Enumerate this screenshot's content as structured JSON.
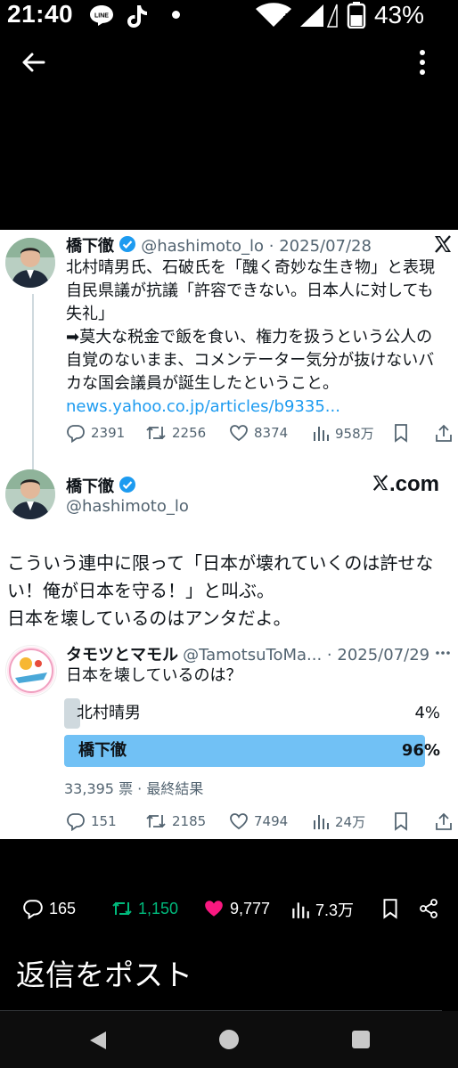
{
  "status_bar": {
    "time": "21:40",
    "battery": "43%",
    "line_badge": "LINE"
  },
  "quoted_tweet": {
    "author_name": "橋下徹",
    "handle_date": "@hashimoto_lo · 2025/07/28",
    "lines": [
      "北村晴男氏、石破氏を「醜く奇妙な生き物」と表現",
      "自民県議が抗議「許容できない。日本人に対しても",
      "失礼」",
      "➡莫大な税金で飯を食い、権力を扱うという公人の",
      "自覚のないまま、コメンテーター気分が抜けないバ",
      "カな国会議員が誕生したということ。"
    ],
    "link": "news.yahoo.co.jp/articles/b9335...",
    "replies": "2391",
    "reposts": "2256",
    "likes": "8374",
    "views": "958万"
  },
  "main_tweet": {
    "author_name": "橋下徹",
    "handle": "@hashimoto_lo",
    "brand": "X.com",
    "brand_rest": ".com",
    "lines": [
      "こういう連中に限って「日本が壊れていくのは許せな",
      "い！俺が日本を守る！」と叫ぶ。",
      "日本を壊しているのはアンタだよ。"
    ]
  },
  "poll_tweet": {
    "author_name": "タモツとマモル",
    "handle_date": "@TamotsuToMa... · 2025/07/29",
    "question": "日本を壊しているのは？",
    "options": [
      {
        "label": "北村晴男",
        "percent": "4%",
        "fraction": 0.04
      },
      {
        "label": "橋下徹",
        "percent": "96%",
        "fraction": 0.96
      }
    ],
    "footer": "33,395 票 · 最終結果",
    "replies": "151",
    "reposts": "2185",
    "likes": "7494",
    "views": "24万"
  },
  "bottom_actions": {
    "replies": "165",
    "reposts": "1,150",
    "likes": "9,777",
    "views": "7.3万"
  },
  "reply_prompt": "返信をポスト",
  "colors": {
    "accent": "#1d9bf0",
    "poll_winner": "#71c1f5",
    "repost_green": "#00ba7c",
    "like_pink": "#f91880"
  }
}
